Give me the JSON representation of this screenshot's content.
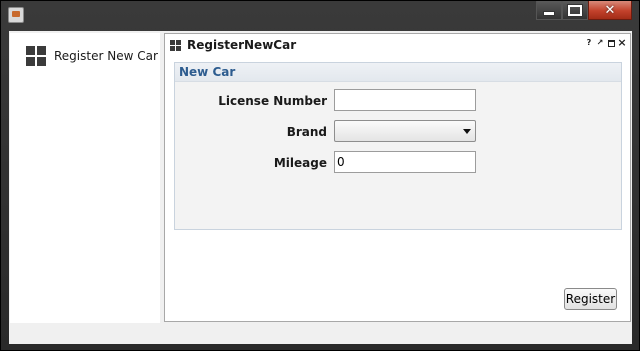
{
  "window": {
    "app_icon": "java-cup-icon",
    "controls": {
      "minimize": "minimize-icon",
      "maximize": "maximize-icon",
      "close": "close-icon",
      "close_glyph": "✕"
    }
  },
  "sidebar": {
    "items": [
      {
        "label": "Register New Car",
        "icon": "grid-icon"
      }
    ]
  },
  "frame": {
    "title": "RegisterNewCar",
    "icon": "grid-icon",
    "controls": {
      "help": "?",
      "pin": "↗",
      "close": "×"
    }
  },
  "form": {
    "section_title": "New Car",
    "fields": [
      {
        "label": "License Number",
        "value": ""
      },
      {
        "label": "Brand",
        "value": ""
      },
      {
        "label": "Mileage",
        "value": "0"
      }
    ]
  },
  "actions": {
    "register_label": "Register"
  },
  "colors": {
    "section_title": "#2d5c8f",
    "close_button": "#c2412b"
  }
}
